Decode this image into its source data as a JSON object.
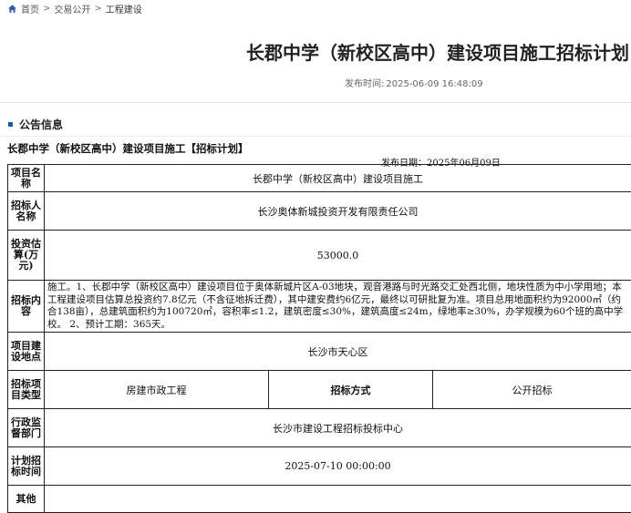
{
  "breadcrumb": {
    "home": "首页",
    "sep": ">",
    "trade": "交易公开",
    "current": "工程建设"
  },
  "page_title": "长郡中学（新校区高中）建设项目施工招标计划",
  "publish_time": {
    "label": "发布时间:",
    "value": "2025-06-09 16:48:09"
  },
  "section_title": "公告信息",
  "notice": {
    "title": "长郡中学（新校区高中）建设项目施工【招标计划】",
    "date": "发布日期：2025年06月09日"
  },
  "table": {
    "project_name_label": "项目名称",
    "project_name": "长郡中学（新校区高中）建设项目施工",
    "tenderer_label": "招标人名称",
    "tenderer": "长沙奥体新城投资开发有限责任公司",
    "estimate_label": "投资估算(万元)",
    "estimate": "53000.0",
    "content_label": "招标内容",
    "content": "施工。1、长郡中学（新校区高中）建设项目位于奥体新城片区A-03地块，观音港路与时光路交汇处西北侧，地块性质为中小学用地；本工程建设项目估算总投资约7.8亿元（不含征地拆迁费），其中建安费约6亿元，最终以可研批复为准。项目总用地面积约为92000㎡（约合138亩），总建筑面积约为100720㎡，容积率≤1.2，建筑密度≤30%，建筑高度≤24m，绿地率≥30%，办学规模为60个班的高中学校。 2、预计工期：365天。",
    "location_label": "项目建设地点",
    "location": "长沙市天心区",
    "type_label": "招标项目类型",
    "type": "房建市政工程",
    "method_label": "招标方式",
    "method": "公开招标",
    "supervisor_label": "行政监督部门",
    "supervisor": "长沙市建设工程招标投标中心",
    "plan_time_label": "计划招标时间",
    "plan_time": "2025-07-10 00:00:00",
    "other_label": "其他"
  },
  "colors": {
    "accent": "#1a58a8",
    "border": "#222222"
  },
  "icons": {
    "home": "home-icon"
  }
}
